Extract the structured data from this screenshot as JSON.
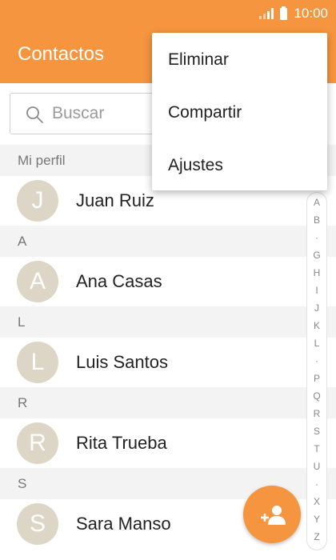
{
  "status_bar": {
    "time": "10:00",
    "signal_icon": "signal-icon",
    "battery_icon": "battery-icon"
  },
  "app": {
    "title": "Contactos",
    "accent_color": "#f6953f"
  },
  "search": {
    "placeholder": "Buscar",
    "value": ""
  },
  "my_profile": {
    "header": "Mi perfil",
    "name": "Juan Ruiz",
    "initial": "J"
  },
  "sections": [
    {
      "letter": "A",
      "contacts": [
        {
          "name": "Ana Casas",
          "initial": "A"
        }
      ]
    },
    {
      "letter": "L",
      "contacts": [
        {
          "name": "Luis Santos",
          "initial": "L"
        }
      ]
    },
    {
      "letter": "R",
      "contacts": [
        {
          "name": "Rita Trueba",
          "initial": "R"
        }
      ]
    },
    {
      "letter": "S",
      "contacts": [
        {
          "name": "Sara Manso",
          "initial": "S"
        }
      ]
    }
  ],
  "index_letters": [
    "A",
    "B",
    "·",
    "G",
    "H",
    "I",
    "J",
    "K",
    "L",
    "·",
    "P",
    "Q",
    "R",
    "S",
    "T",
    "U",
    "·",
    "X",
    "Y",
    "Z"
  ],
  "menu": {
    "items": [
      "Eliminar",
      "Compartir",
      "Ajustes"
    ]
  },
  "fab": {
    "icon": "add-contact-icon"
  }
}
